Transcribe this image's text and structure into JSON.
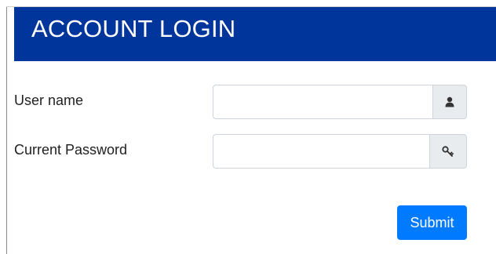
{
  "header": {
    "title": "ACCOUNT LOGIN"
  },
  "form": {
    "username": {
      "label": "User name",
      "value": "",
      "placeholder": "",
      "icon": "user-icon"
    },
    "password": {
      "label": "Current Password",
      "value": "",
      "placeholder": "",
      "icon": "key-icon"
    },
    "submit_label": "Submit"
  },
  "colors": {
    "header_bg": "#00359c",
    "button_bg": "#007bff",
    "addon_bg": "#e9ecef"
  }
}
